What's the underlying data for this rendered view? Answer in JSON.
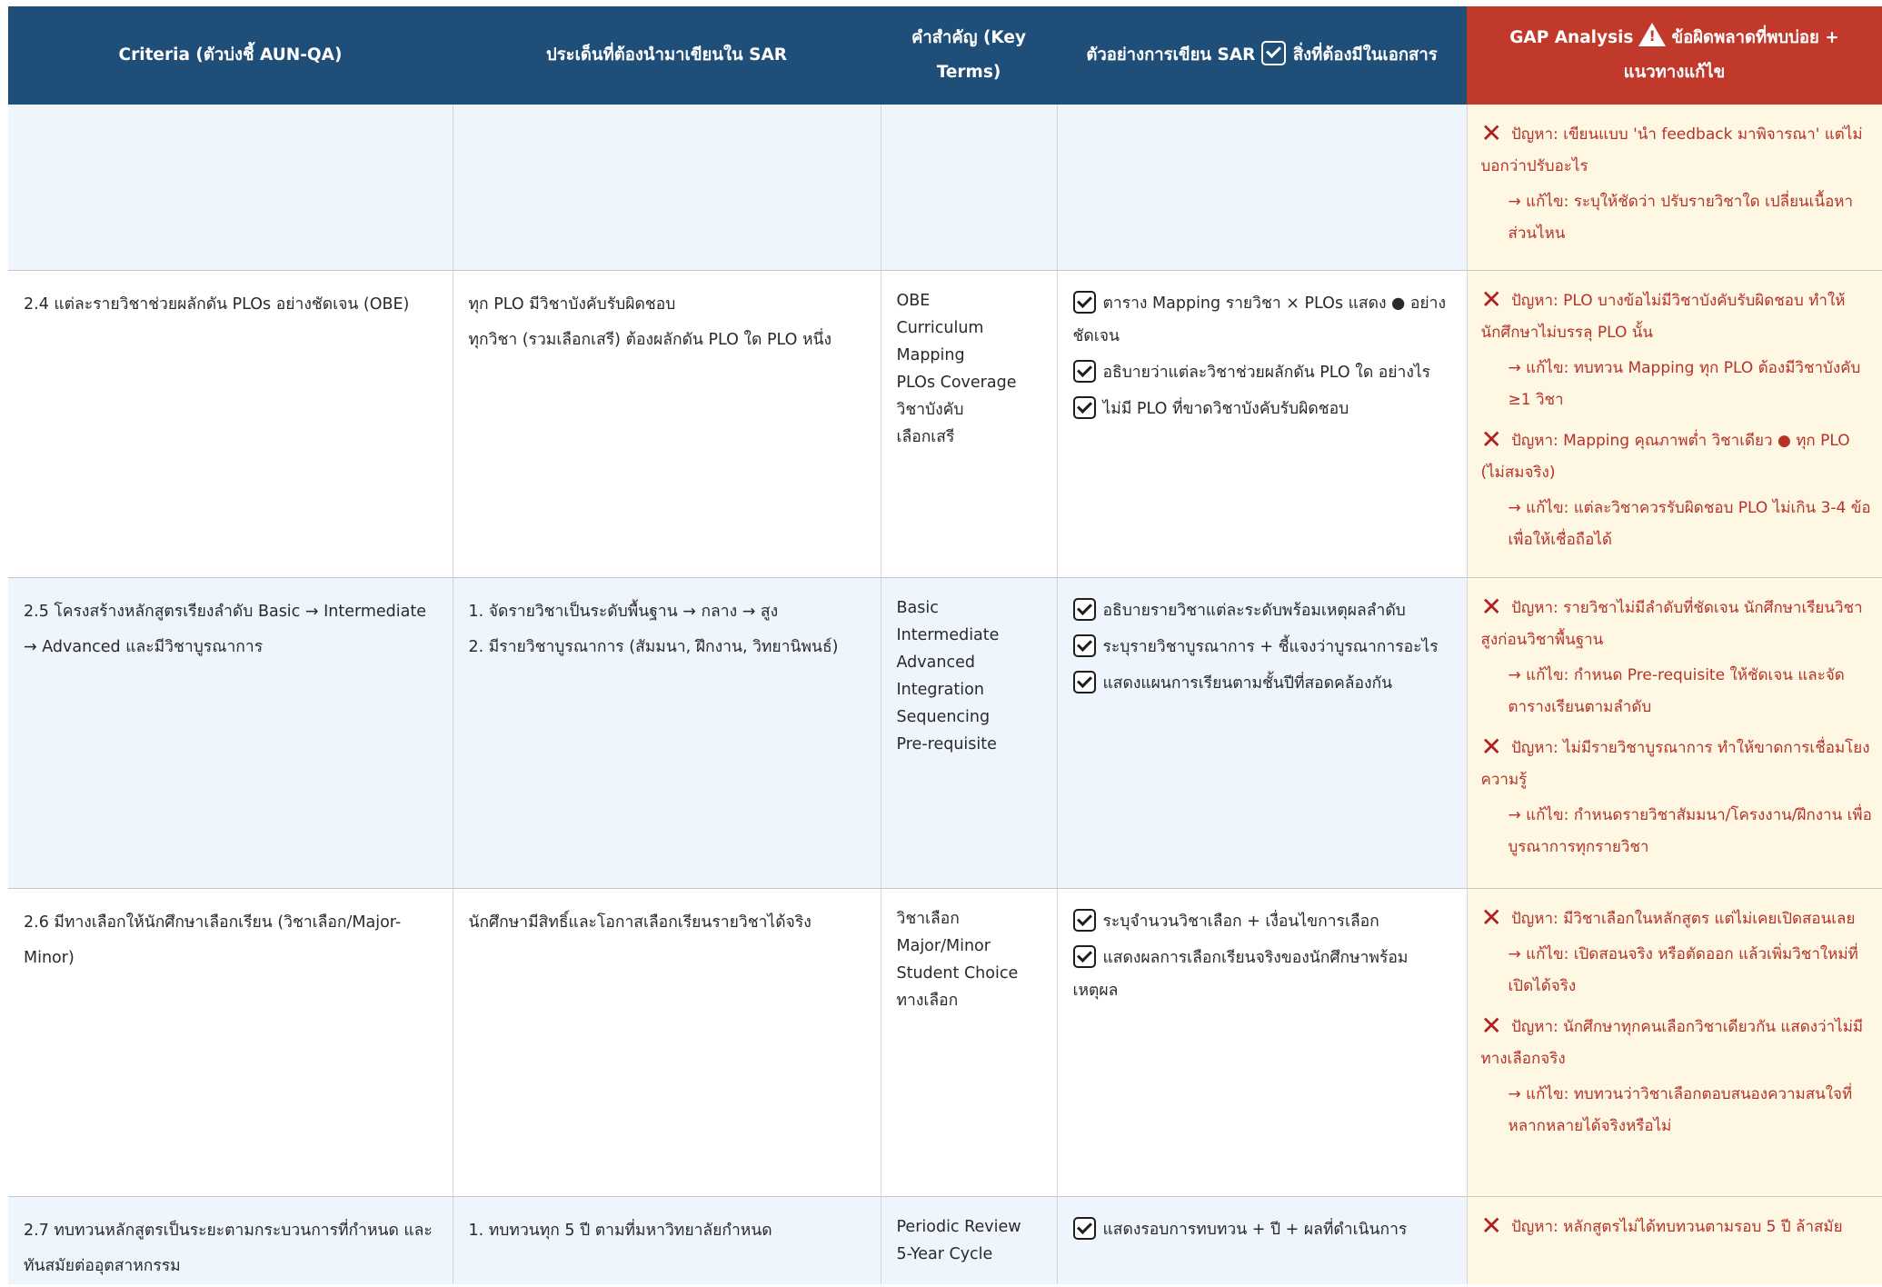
{
  "headers": {
    "criteria": "Criteria (ตัวบ่งชี้ AUN-QA)",
    "issues": "ประเด็นที่ต้องนำมาเขียนใน SAR",
    "keyterms": "คำสำคัญ (Key Terms)",
    "examples_prefix": "ตัวอย่างการเขียน SAR",
    "examples_suffix": "สิ่งที่ต้องมีในเอกสาร",
    "gap_prefix": "GAP Analysis",
    "gap_suffix": "ข้อผิดพลาดที่พบบ่อย + แนวทางแก้ไข"
  },
  "rows": [
    {
      "criteria": "",
      "issues": [],
      "keyterms": [],
      "examples": [],
      "gap": [
        {
          "problem": "ปัญหา: เขียนแบบ 'นำ feedback มาพิจารณา' แต่ไม่บอกว่าปรับอะไร",
          "fix": "→ แก้ไข: ระบุให้ชัดว่า ปรับรายวิชาใด เปลี่ยนเนื้อหาส่วนไหน"
        }
      ]
    },
    {
      "criteria": "2.4 แต่ละรายวิชาช่วยผลักดัน PLOs อย่างชัดเจน (OBE)",
      "issues": [
        "ทุก PLO มีวิชาบังคับรับผิดชอบ",
        "ทุกวิชา (รวมเลือกเสรี) ต้องผลักดัน PLO ใด PLO หนึ่ง"
      ],
      "keyterms": [
        "OBE",
        "Curriculum",
        "Mapping",
        "PLOs Coverage",
        "วิชาบังคับ",
        "เลือกเสรี"
      ],
      "examples": [
        "ตาราง Mapping รายวิชา × PLOs แสดง ● อย่างชัดเจน",
        "อธิบายว่าแต่ละวิชาช่วยผลักดัน PLO ใด อย่างไร",
        "ไม่มี PLO ที่ขาดวิชาบังคับรับผิดชอบ"
      ],
      "gap": [
        {
          "problem": "ปัญหา: PLO บางข้อไม่มีวิชาบังคับรับผิดชอบ ทำให้นักศึกษาไม่บรรลุ PLO นั้น",
          "fix": "→ แก้ไข: ทบทวน Mapping ทุก PLO ต้องมีวิชาบังคับ ≥1 วิชา"
        },
        {
          "problem": "ปัญหา: Mapping คุณภาพต่ำ วิชาเดียว ● ทุก PLO (ไม่สมจริง)",
          "fix": "→ แก้ไข: แต่ละวิชาควรรับผิดชอบ PLO ไม่เกิน 3-4 ข้อ เพื่อให้เชื่อถือได้"
        }
      ]
    },
    {
      "criteria": "2.5 โครงสร้างหลักสูตรเรียงลำดับ Basic → Intermediate → Advanced และมีวิชาบูรณาการ",
      "issues": [
        "1. จัดรายวิชาเป็นระดับพื้นฐาน → กลาง → สูง",
        "2. มีรายวิชาบูรณาการ (สัมมนา, ฝึกงาน, วิทยานิพนธ์)"
      ],
      "keyterms": [
        "Basic",
        "Intermediate",
        "Advanced",
        "Integration",
        "Sequencing",
        "Pre-requisite"
      ],
      "examples": [
        "อธิบายรายวิชาแต่ละระดับพร้อมเหตุผลลำดับ",
        "ระบุรายวิชาบูรณาการ + ชี้แจงว่าบูรณาการอะไร",
        "แสดงแผนการเรียนตามชั้นปีที่สอดคล้องกัน"
      ],
      "gap": [
        {
          "problem": "ปัญหา: รายวิชาไม่มีลำดับที่ชัดเจน นักศึกษาเรียนวิชาสูงก่อนวิชาพื้นฐาน",
          "fix": "→ แก้ไข: กำหนด Pre-requisite ให้ชัดเจน และจัดตารางเรียนตามลำดับ"
        },
        {
          "problem": "ปัญหา: ไม่มีรายวิชาบูรณาการ ทำให้ขาดการเชื่อมโยงความรู้",
          "fix": "→ แก้ไข: กำหนดรายวิชาสัมมนา/โครงงาน/ฝึกงาน เพื่อบูรณาการทุกรายวิชา"
        }
      ]
    },
    {
      "criteria": "2.6 มีทางเลือกให้นักศึกษาเลือกเรียน (วิชาเลือก/Major-Minor)",
      "issues": [
        "นักศึกษามีสิทธิ์และโอกาสเลือกเรียนรายวิชาได้จริง"
      ],
      "keyterms": [
        "วิชาเลือก",
        "Major/Minor",
        "Student Choice",
        "ทางเลือก"
      ],
      "examples": [
        "ระบุจำนวนวิชาเลือก + เงื่อนไขการเลือก",
        "แสดงผลการเลือกเรียนจริงของนักศึกษาพร้อมเหตุผล"
      ],
      "gap": [
        {
          "problem": "ปัญหา: มีวิชาเลือกในหลักสูตร แต่ไม่เคยเปิดสอนเลย",
          "fix": "→ แก้ไข: เปิดสอนจริง หรือตัดออก แล้วเพิ่มวิชาใหม่ที่เปิดได้จริง"
        },
        {
          "problem": "ปัญหา: นักศึกษาทุกคนเลือกวิชาเดียวกัน แสดงว่าไม่มีทางเลือกจริง",
          "fix": "→ แก้ไข: ทบทวนว่าวิชาเลือกตอบสนองความสนใจที่หลากหลายได้จริงหรือไม่"
        }
      ]
    },
    {
      "criteria": "2.7 ทบทวนหลักสูตรเป็นระยะตามกระบวนการที่กำหนด และทันสมัยต่ออุตสาหกรรม",
      "issues": [
        "1. ทบทวนทุก 5 ปี ตามที่มหาวิทยาลัยกำหนด"
      ],
      "keyterms": [
        "Periodic Review",
        "5-Year Cycle"
      ],
      "examples": [
        "แสดงรอบการทบทวน + ปี + ผลที่ดำเนินการ"
      ],
      "gap": [
        {
          "problem": "ปัญหา: หลักสูตรไม่ได้ทบทวนตามรอบ 5 ปี ล้าสมัย",
          "fix": ""
        }
      ]
    }
  ]
}
